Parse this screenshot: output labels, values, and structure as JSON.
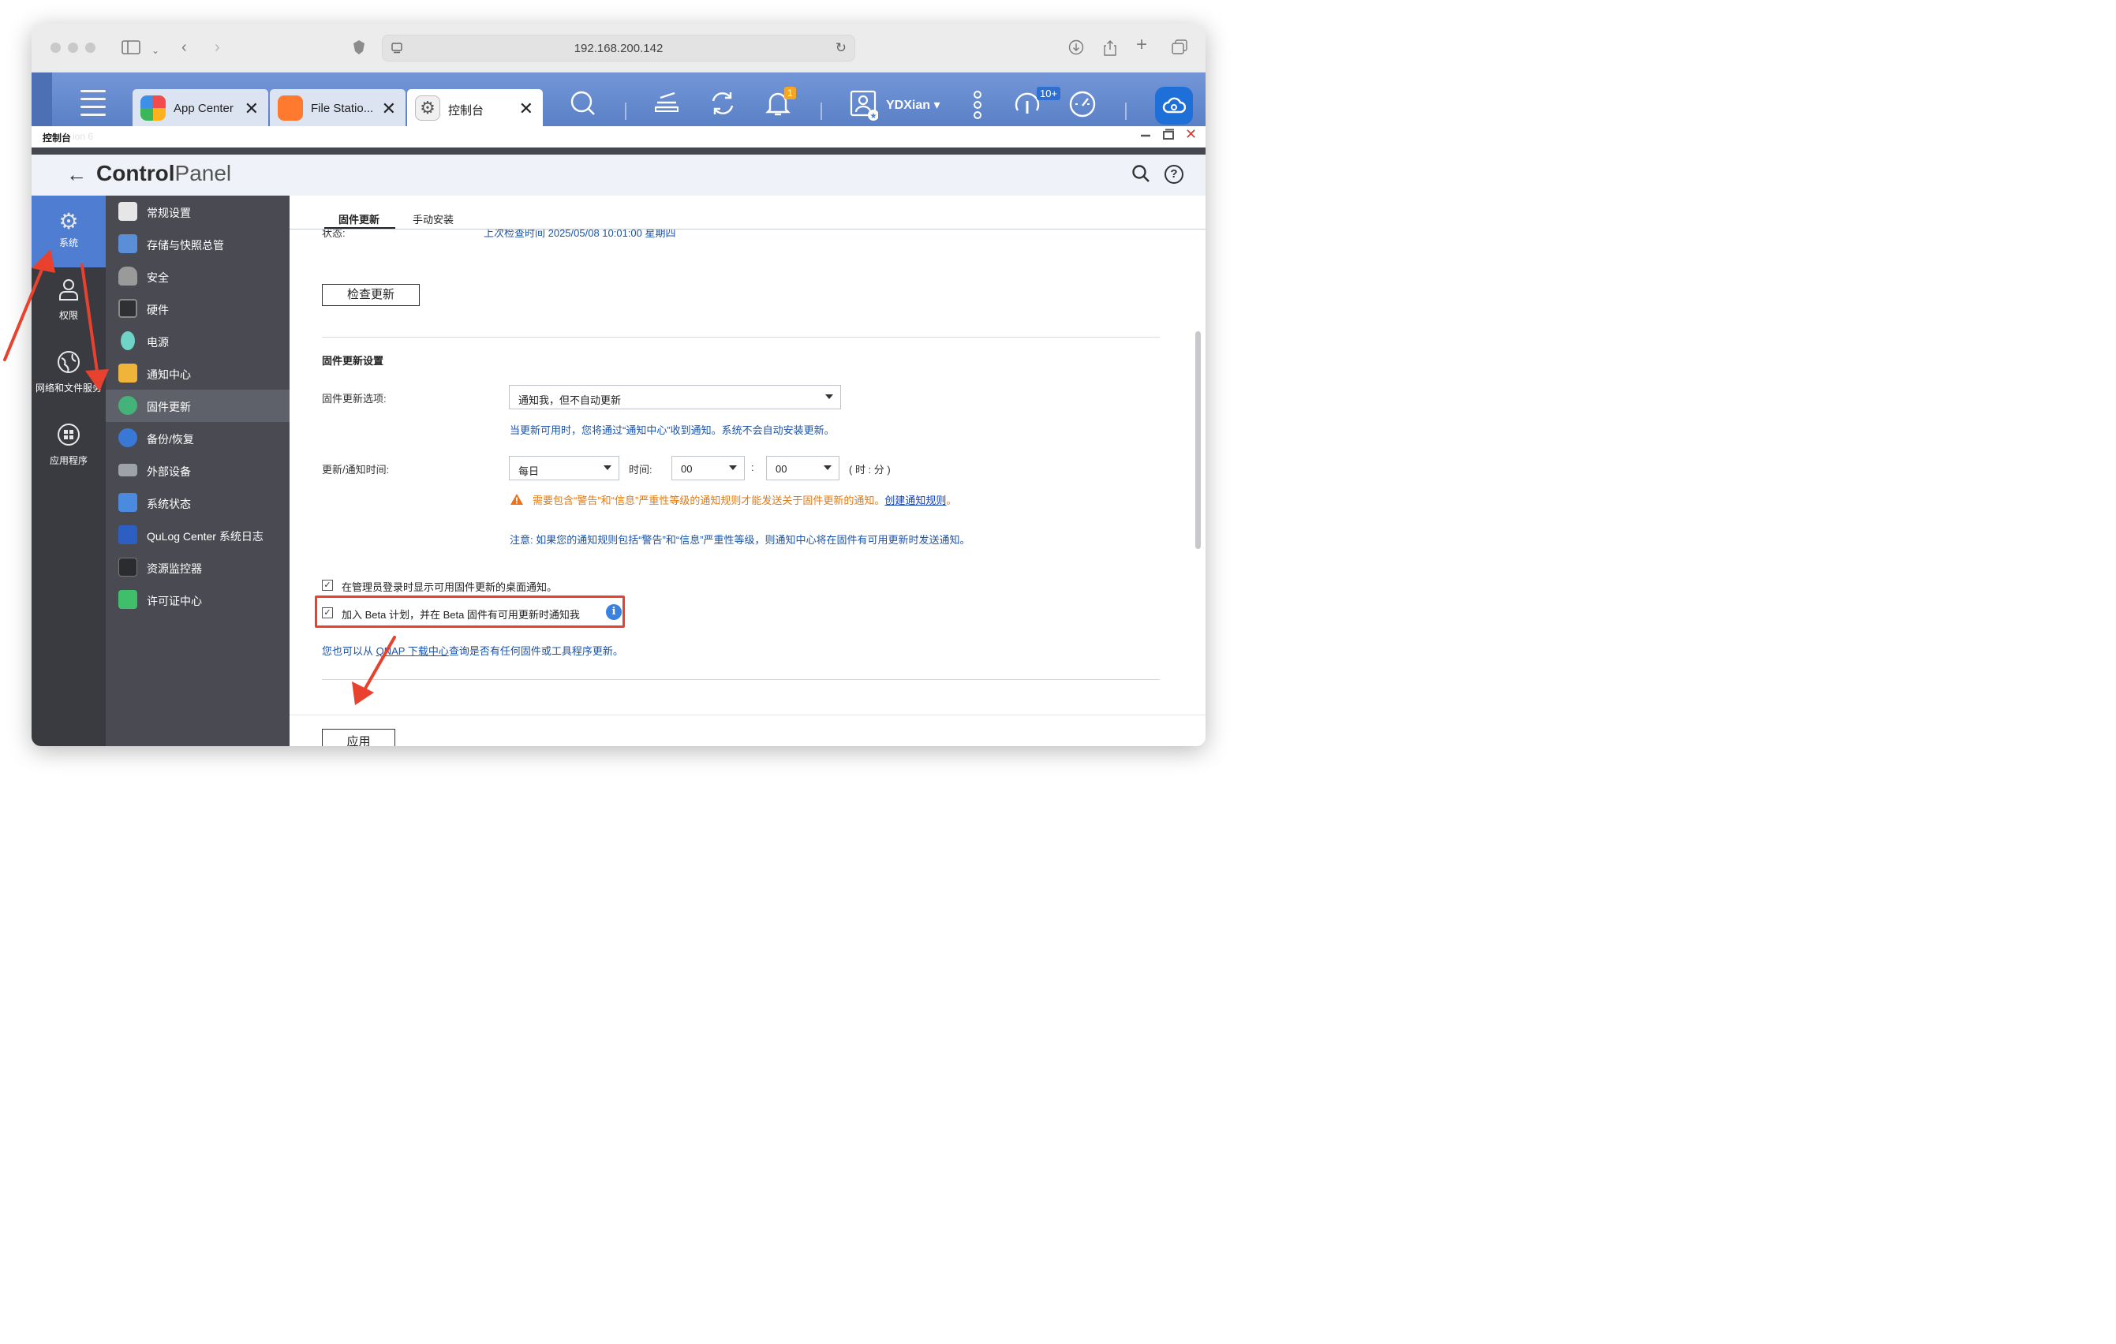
{
  "browser": {
    "url": "192.168.200.142"
  },
  "taskbar": {
    "tabs": [
      {
        "label": "App Center",
        "close": "✕"
      },
      {
        "label": "File Statio...",
        "close": "✕"
      },
      {
        "label": "控制台",
        "close": "✕"
      }
    ],
    "notification_badge": "1",
    "user_name": "YDXian ▾",
    "resource_badge": "10+"
  },
  "window": {
    "caption": "控制台",
    "caption_ghost": "ion 6"
  },
  "header": {
    "title_bold": "Control",
    "title_thin": "Panel"
  },
  "rail": {
    "items": [
      {
        "label": "系统"
      },
      {
        "label": "权限"
      },
      {
        "label": "网络和文件服务"
      },
      {
        "label": "应用程序"
      }
    ]
  },
  "menu": {
    "items": [
      {
        "label": "常规设置"
      },
      {
        "label": "存储与快照总管"
      },
      {
        "label": "安全"
      },
      {
        "label": "硬件"
      },
      {
        "label": "电源"
      },
      {
        "label": "通知中心"
      },
      {
        "label": "固件更新"
      },
      {
        "label": "备份/恢复"
      },
      {
        "label": "外部设备"
      },
      {
        "label": "系统状态"
      },
      {
        "label": "QuLog Center 系统日志"
      },
      {
        "label": "资源监控器"
      },
      {
        "label": "许可证中心"
      }
    ],
    "active_index": 6
  },
  "content": {
    "tabs": [
      "固件更新",
      "手动安装"
    ],
    "status_label": "状态:",
    "status_value": "上次检查时间 2025/05/08 10:01:00 星期四",
    "check_button": "检查更新",
    "section_title": "固件更新设置",
    "option_label": "固件更新选项:",
    "option_value": "通知我，但不自动更新",
    "option_hint": "当更新可用时，您将通过“通知中心”收到通知。系统不会自动安装更新。",
    "time_label": "更新/通知时间:",
    "frequency_value": "每日",
    "time_word": "时间:",
    "hour_value": "00",
    "colon": ":",
    "minute_value": "00",
    "time_unit": "( 时 : 分 )",
    "warning_text": "需要包含“警告”和“信息”严重性等级的通知规则才能发送关于固件更新的通知。",
    "warning_link": "创建通知规则",
    "warning_end": "。",
    "note_text": "注意:  如果您的通知规则包括“警告”和“信息”严重性等级，则通知中心将在固件有可用更新时发送通知。",
    "checkbox1": "在管理员登录时显示可用固件更新的桌面通知。",
    "checkbox2": "加入 Beta 计划，并在 Beta 固件有可用更新时通知我",
    "checkbox1_checked": true,
    "checkbox2_checked": true,
    "footer_pre": "您也可以从 ",
    "footer_link": "QNAP 下载中心",
    "footer_post": "查询是否有任何固件或工具程序更新。",
    "apply_button": "应用"
  },
  "colors": {
    "accent": "#4f7dd1",
    "highlight": "#e8412e",
    "warning": "#e07a14",
    "link": "#1b53a8"
  }
}
